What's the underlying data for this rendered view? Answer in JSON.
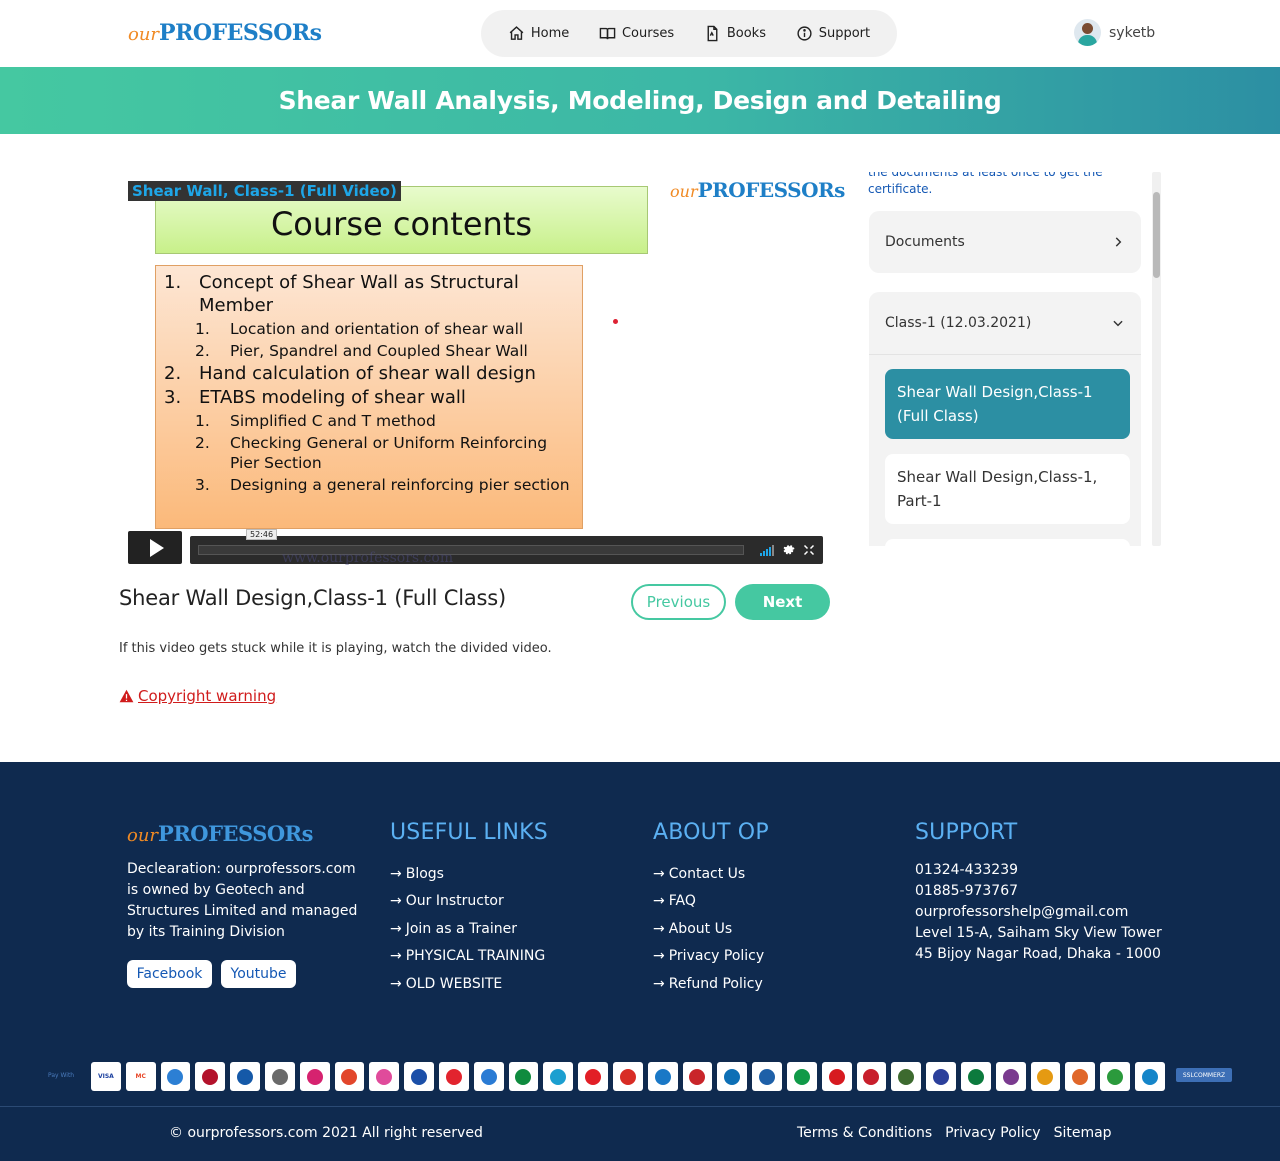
{
  "header": {
    "logo_our": "our",
    "logo_professors": "PROFESSORs",
    "nav": [
      {
        "label": "Home",
        "icon": "home-icon"
      },
      {
        "label": "Courses",
        "icon": "book-open-icon"
      },
      {
        "label": "Books",
        "icon": "pdf-file-icon"
      },
      {
        "label": "Support",
        "icon": "info-icon"
      }
    ],
    "username": "syketb"
  },
  "banner": {
    "title": "Shear Wall Analysis, Modeling, Design and Detailing"
  },
  "video": {
    "overlay_title": "Shear Wall, Class-1 (Full Video)",
    "slide_title": "Course contents",
    "slide_logo_our": "our",
    "slide_logo_professors": "PROFESSORs",
    "slide_items": [
      {
        "level": 1,
        "num": "1.",
        "text": "Concept of Shear Wall as Structural Member"
      },
      {
        "level": 2,
        "num": "1.",
        "text": "Location and orientation of shear wall"
      },
      {
        "level": 2,
        "num": "2.",
        "text": "Pier, Spandrel and Coupled Shear Wall"
      },
      {
        "level": 1,
        "num": "2.",
        "text": "Hand calculation of shear wall design"
      },
      {
        "level": 1,
        "num": "3.",
        "text": "ETABS modeling of shear wall"
      },
      {
        "level": 2,
        "num": "1.",
        "text": "Simplified C and T method"
      },
      {
        "level": 2,
        "num": "2.",
        "text": "Checking General or Uniform Reinforcing Pier Section"
      },
      {
        "level": 2,
        "num": "3.",
        "text": "Designing a general reinforcing pier section"
      }
    ],
    "timecode": "52:46",
    "watermark": "www.ourprofessors.com"
  },
  "lesson": {
    "title": "Shear Wall Design,Class-1 (Full Class)",
    "previous_label": "Previous",
    "next_label": "Next",
    "stuck_note": "If this video gets stuck while it is playing, watch the divided video.",
    "copyright_warning": "Copyright warning"
  },
  "sidebar": {
    "note_cut": "the documents at least once to get the",
    "note_end": "certificate.",
    "documents_label": "Documents",
    "class_label": "Class-1 (12.03.2021)",
    "lessons": [
      {
        "label": "Shear Wall Design,Class-1 (Full Class)",
        "active": true
      },
      {
        "label": "Shear Wall Design,Class-1, Part-1",
        "active": false
      }
    ]
  },
  "footer": {
    "logo_our": "our",
    "logo_professors": "PROFESSORs",
    "declaration": "Declearation: ourprofessors.com is owned by Geotech and Structures Limited and managed by its Training Division",
    "social": [
      "Facebook",
      "Youtube"
    ],
    "useful_links": {
      "heading": "USEFUL LINKS",
      "items": [
        "Blogs",
        "Our Instructor",
        "Join as a Trainer",
        "PHYSICAL TRAINING",
        "OLD WEBSITE"
      ]
    },
    "about": {
      "heading": "ABOUT OP",
      "items": [
        "Contact Us",
        "FAQ",
        "About Us",
        "Privacy Policy",
        "Refund Policy"
      ]
    },
    "support": {
      "heading": "SUPPORT",
      "lines": [
        "01324-433239",
        "01885-973767",
        "ourprofessorshelp@gmail.com",
        "Level 15-A, Saiham Sky View Tower",
        "45 Bijoy Nagar Road, Dhaka - 1000"
      ]
    },
    "pay_with": "Pay With",
    "payment_methods": [
      "VISA",
      "MC",
      "AMEX",
      "UNIONPAY",
      "DINERS",
      "DBBL",
      "bKash",
      "SureCash",
      "Upay",
      "Tap",
      "NexusPay",
      "Fsiblgr",
      "mCash",
      "Dmoney",
      "Rocket",
      "OkWallet",
      "Citytouch",
      "EBL",
      "Bank Asia",
      "DBBL IB",
      "IFIC",
      "AB Bank",
      "MTB",
      "Meghna",
      "SBL",
      "Islami",
      "Modhumoti",
      "Instapay",
      "Sonali",
      "Sheba",
      "iPay"
    ],
    "ssl_badge": "SSLCOMMERZ",
    "copyright": "© ourprofessors.com 2021 All right reserved",
    "bottom_links": [
      "Terms & Conditions",
      "Privacy Policy",
      "Sitemap"
    ]
  },
  "colors": {
    "accent": "#45c8a1",
    "teal_dark": "#2c8fa3",
    "footer_bg": "#0f2a4f",
    "warning": "#d01c1c"
  }
}
